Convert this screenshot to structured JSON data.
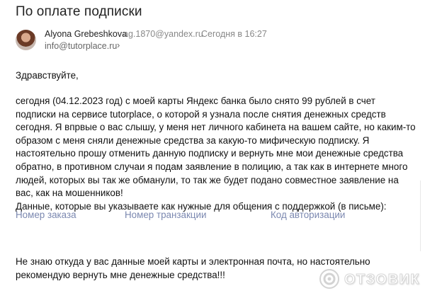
{
  "email": {
    "subject": "По оплате подписки",
    "sender_name": "Alyona Grebeshkova",
    "sender_email": "ag.1870@yandex.ru",
    "sent_date": "Сегодня в 16:27",
    "recipient": "info@tutorplace.ru",
    "recipient_chevron": "›",
    "greeting": "Здравствуйте,",
    "paragraph_lines": [
      "сегодня (04.12.2023 год) с моей карты Яндекс банка было снято 99 рублей в счет",
      "подписки на сервисе tutorplace, о которой я узнала после снятия денежных средств",
      "сегодня. Я впрвые о вас слышу, у меня нет личного кабинета на вашем сайте, но каким-то",
      "образом с меня сняли денежные средства за какую-то мифическую подписку. Я",
      "настоятельно прошу отменить данную подписку и вернуть мне мои денежные средства",
      "обратно, в противном случаи я подам заявление в полицию, а так как в интернете много",
      "людей, которых вы так же обманули, то так же будет подано совместное заявление на",
      "вас, как на мошенников!",
      "Данные, которые вы указываете как нужные для общения с поддержкой (в письме):"
    ],
    "fields": [
      "Номер заказа",
      "Номер транзакции",
      "Код авторизации"
    ],
    "closing_lines": [
      "Не знаю откуда у вас данные моей карты и электронная почта, но настоятельно",
      "рекомендую вернуть мне денежные средства!!!"
    ]
  },
  "watermark": {
    "text": "ОТЗОВИК",
    "icon": "otzovik-logo-icon"
  }
}
